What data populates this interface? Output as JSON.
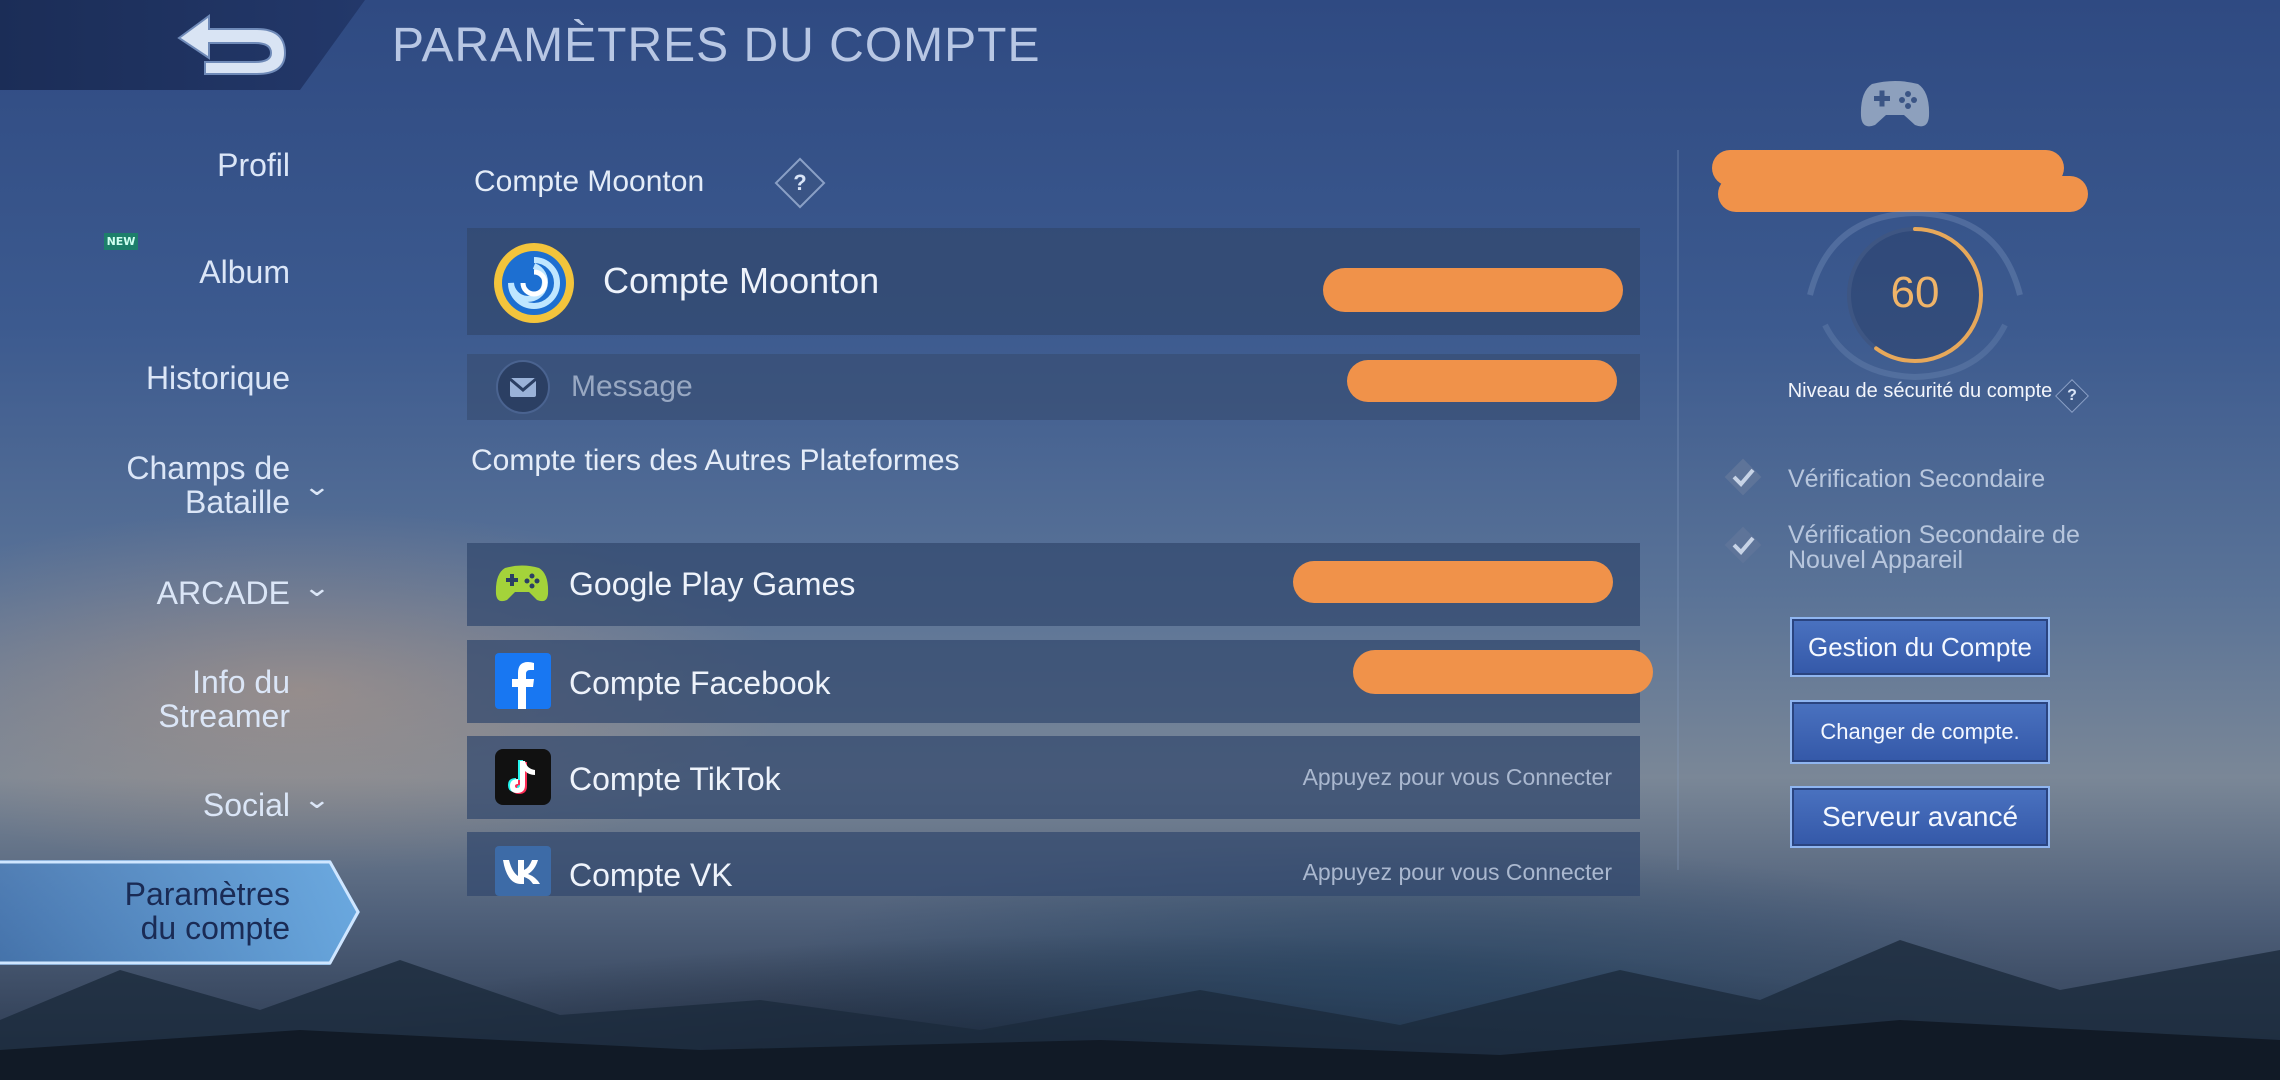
{
  "header": {
    "title": "PARAMÈTRES DU COMPTE",
    "back_icon": "back-arrow-icon"
  },
  "sidebar": {
    "items": [
      {
        "label": "Profil",
        "chevron": false
      },
      {
        "label": "Album",
        "badge": "NEW",
        "chevron": false
      },
      {
        "label": "Historique",
        "chevron": false
      },
      {
        "label_line1": "Champs de",
        "label_line2": "Bataille",
        "chevron": true
      },
      {
        "label": "ARCADE",
        "chevron": true
      },
      {
        "label_line1": "Info du",
        "label_line2": "Streamer",
        "chevron": false
      },
      {
        "label": "Social",
        "chevron": true
      },
      {
        "label_line1": "Paramètres",
        "label_line2": "du compte",
        "active": true
      }
    ]
  },
  "main": {
    "moonton_section_title": "Compte Moonton",
    "moonton_account": {
      "label": "Compte Moonton",
      "icon": "moonton-logo-icon"
    },
    "message": {
      "label": "Message",
      "icon": "mail-icon"
    },
    "third_party_title": "Compte tiers des Autres Plateformes",
    "accounts": [
      {
        "label": "Google Play Games",
        "icon": "gamepad-icon",
        "status": ""
      },
      {
        "label": "Compte Facebook",
        "icon": "facebook-icon",
        "status": ""
      },
      {
        "label": "Compte TikTok",
        "icon": "tiktok-icon",
        "status": "Appuyez pour vous Connecter"
      },
      {
        "label": "Compte VK",
        "icon": "vk-icon",
        "status": "Appuyez pour vous Connecter"
      }
    ]
  },
  "right_panel": {
    "platform_icon": "gamepad-icon",
    "security_score": "60",
    "security_fraction": 0.6,
    "security_label": "Niveau de sécurité du compte",
    "checks": [
      {
        "label": "Vérification Secondaire"
      },
      {
        "label_line1": "Vérification Secondaire de",
        "label_line2": "Nouvel Appareil"
      }
    ],
    "buttons": [
      {
        "label": "Gestion du Compte"
      },
      {
        "label": "Changer de compte."
      },
      {
        "label": "Serveur avancé"
      }
    ]
  },
  "colors": {
    "redaction": "#f0924a",
    "score_ring": "#e7a85a",
    "accent_button": "#3f66b6"
  }
}
